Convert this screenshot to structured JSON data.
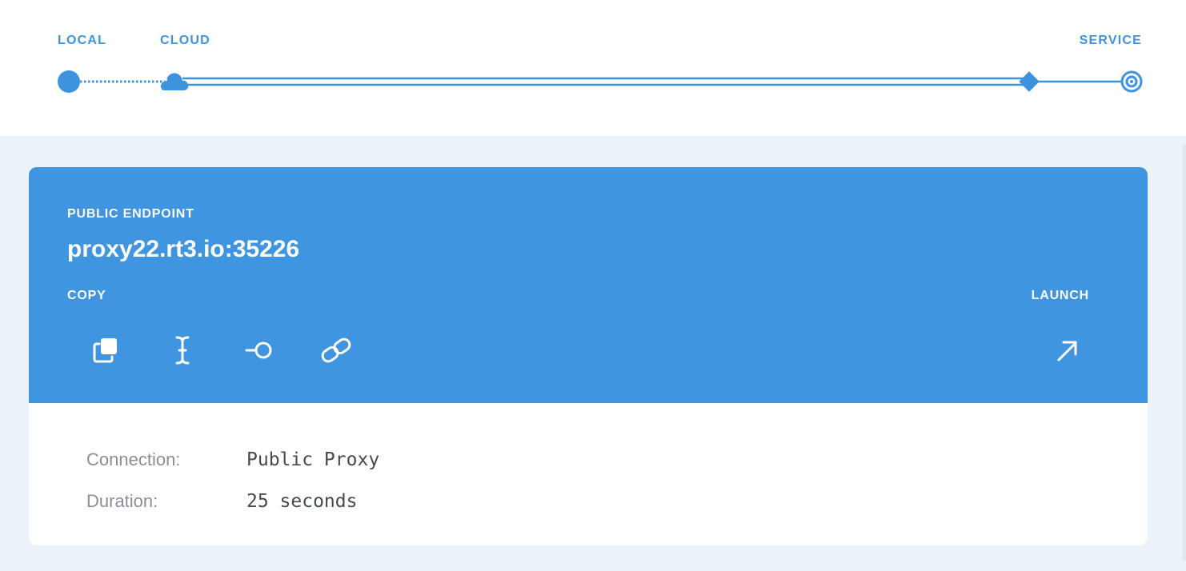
{
  "progress": {
    "stages": {
      "local": "LOCAL",
      "cloud": "CLOUD",
      "service": "SERVICE"
    },
    "icons": [
      "local-node-icon",
      "cloud-icon",
      "diamond-node-icon",
      "target-icon"
    ],
    "accent": "#3d93dd"
  },
  "endpoint": {
    "label": "PUBLIC ENDPOINT",
    "value": "proxy22.rt3.io:35226",
    "copy_label": "COPY",
    "launch_label": "LAUNCH",
    "copy_actions": [
      "copy-icon",
      "cursor-text-icon",
      "key-icon",
      "link-icon"
    ],
    "launch_action": "arrow-up-right-icon",
    "header_color": "#3f95e0"
  },
  "details": {
    "connection_label": "Connection:",
    "connection_value": "Public Proxy",
    "duration_label": "Duration:",
    "duration_value": "25 seconds"
  }
}
